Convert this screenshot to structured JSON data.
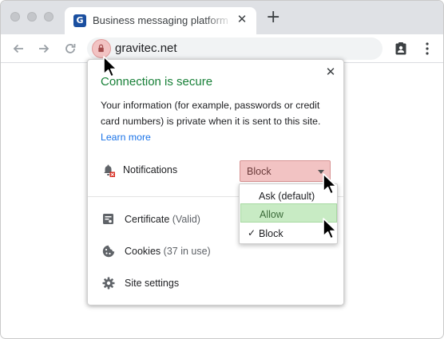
{
  "tab": {
    "title": "Business messaging platform - G",
    "favicon_letter": "G",
    "close": "✕"
  },
  "new_tab": "+",
  "address_bar": {
    "url": "gravitec.net"
  },
  "popup": {
    "close": "✕",
    "title": "Connection is secure",
    "description": "Your information (for example, passwords or credit card numbers) is private when it is sent to this site.",
    "learn_more": "Learn more",
    "notifications": {
      "label": "Notifications",
      "selected": "Block",
      "options": [
        {
          "label": "Ask (default)",
          "checked": false,
          "highlighted": false
        },
        {
          "label": "Allow",
          "checked": false,
          "highlighted": true
        },
        {
          "label": "Block",
          "checked": true,
          "highlighted": false
        }
      ]
    },
    "certificate": {
      "label": "Certificate",
      "detail": "(Valid)"
    },
    "cookies": {
      "label": "Cookies",
      "detail": "(37 in use)"
    },
    "site_settings": {
      "label": "Site settings"
    }
  },
  "colors": {
    "secure_green": "#188038",
    "link_blue": "#1a73e8",
    "block_bg": "#f2c3c3",
    "allow_bg": "#c8ebc4"
  },
  "icons": [
    "back-arrow-icon",
    "forward-arrow-icon",
    "reload-icon",
    "lock-icon",
    "clipboard-account-icon",
    "vertical-dots-icon",
    "bell-blocked-icon",
    "certificate-icon",
    "cookie-icon",
    "gear-icon",
    "mouse-pointer-icon"
  ]
}
